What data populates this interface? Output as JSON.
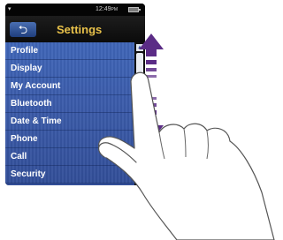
{
  "status": {
    "time": "12:49",
    "ampm": "PM",
    "signal": "A"
  },
  "header": {
    "back_icon": "back-arrow-icon",
    "title": "Settings"
  },
  "menu": {
    "items": [
      {
        "label": "Profile"
      },
      {
        "label": "Display"
      },
      {
        "label": "My Account"
      },
      {
        "label": "Bluetooth"
      },
      {
        "label": "Date & Time"
      },
      {
        "label": "Phone"
      },
      {
        "label": "Call"
      },
      {
        "label": "Security"
      }
    ]
  },
  "colors": {
    "title": "#e8c14a",
    "list_bg": "#3a5aa8",
    "arrow": "#5b2c86"
  },
  "icons": {
    "gesture": "swipe-up-down-arrow-icon",
    "hand": "hand-finger-icon"
  }
}
